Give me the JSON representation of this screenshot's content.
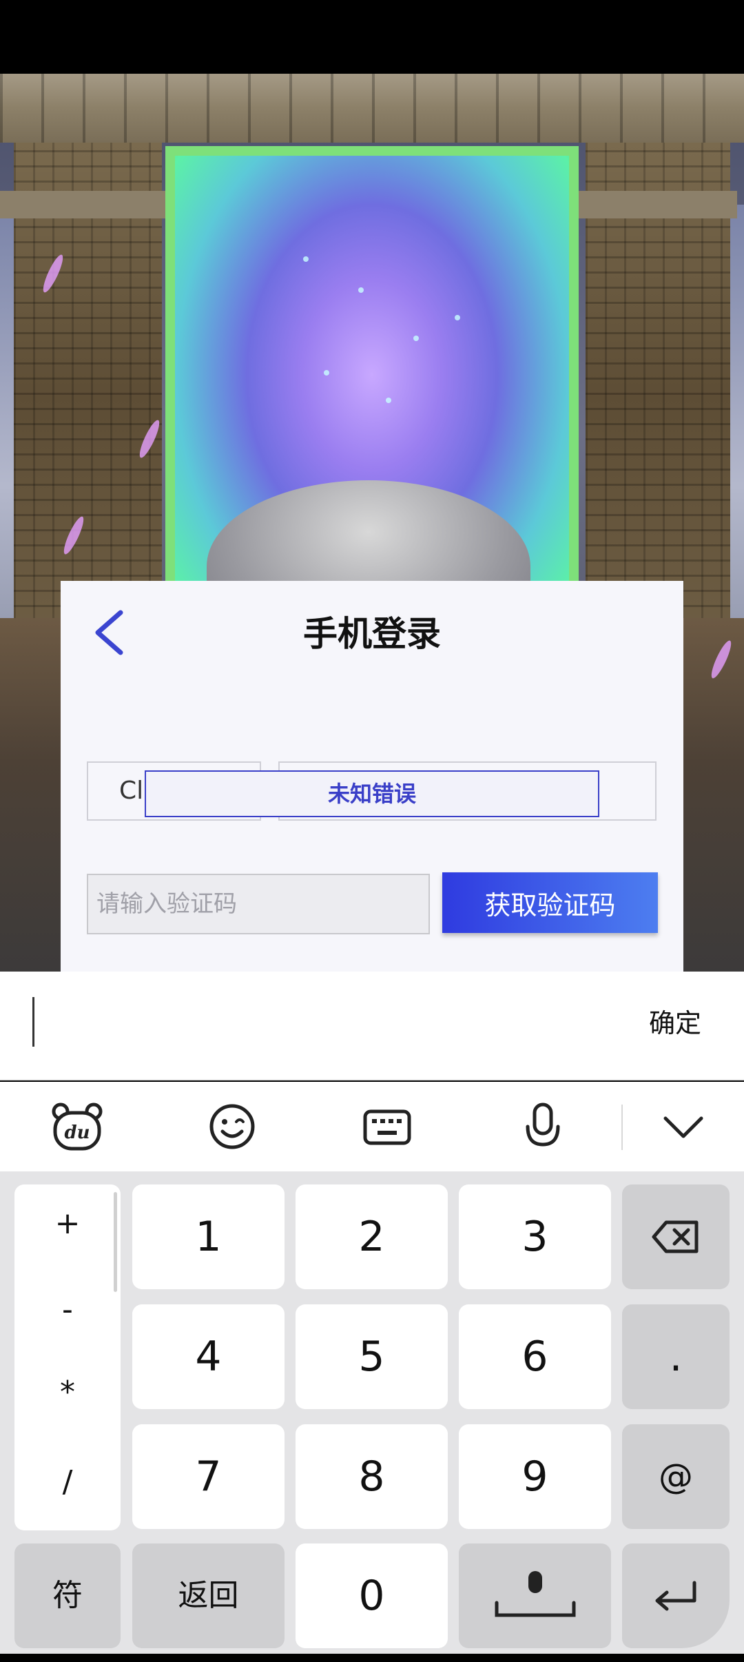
{
  "dialog": {
    "title": "手机登录",
    "country_code_partial": "Cl",
    "error_toast": "未知错误",
    "code_placeholder": "请输入验证码",
    "get_code_label": "获取验证码"
  },
  "ime": {
    "confirm_label": "确定",
    "toolbar_icons": [
      "du-bear-icon",
      "emoji-icon",
      "keyboard-icon",
      "microphone-icon",
      "collapse-chevron-icon"
    ]
  },
  "keypad": {
    "symbols": [
      "+",
      "-",
      "*",
      "/"
    ],
    "digits": [
      "1",
      "2",
      "3",
      "4",
      "5",
      "6",
      "7",
      "8",
      "9",
      "0"
    ],
    "dot": ".",
    "at": "@",
    "symbols_key": "符",
    "back_key": "返回"
  }
}
